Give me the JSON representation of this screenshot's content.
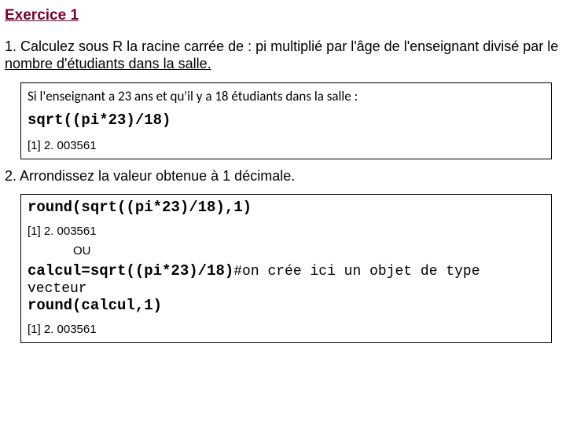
{
  "heading": "Exercice 1",
  "q1": {
    "lead": "1. Calculez sous R la racine carrée de : pi multiplié par l'âge de l'enseignant divisé par le ",
    "underlined": "nombre d'étudiants dans la salle."
  },
  "box1": {
    "condition": "Si l'enseignant a 23 ans et qu'il y a 18 étudiants dans la salle :",
    "code": "sqrt((pi*23)/18)",
    "output": "[1] 2. 003561"
  },
  "q2": "2. Arrondissez la valeur obtenue à 1 décimale.",
  "box2": {
    "code1": "round(sqrt((pi*23)/18),1)",
    "output1": "[1] 2. 003561",
    "or_label": "OU",
    "code2_line1_code": "calcul=sqrt((pi*23)/18)",
    "code2_line1_comment": "#on crée ici un objet de type vecteur",
    "code2_line2": "round(calcul,1)",
    "output2": "[1] 2. 003561"
  }
}
